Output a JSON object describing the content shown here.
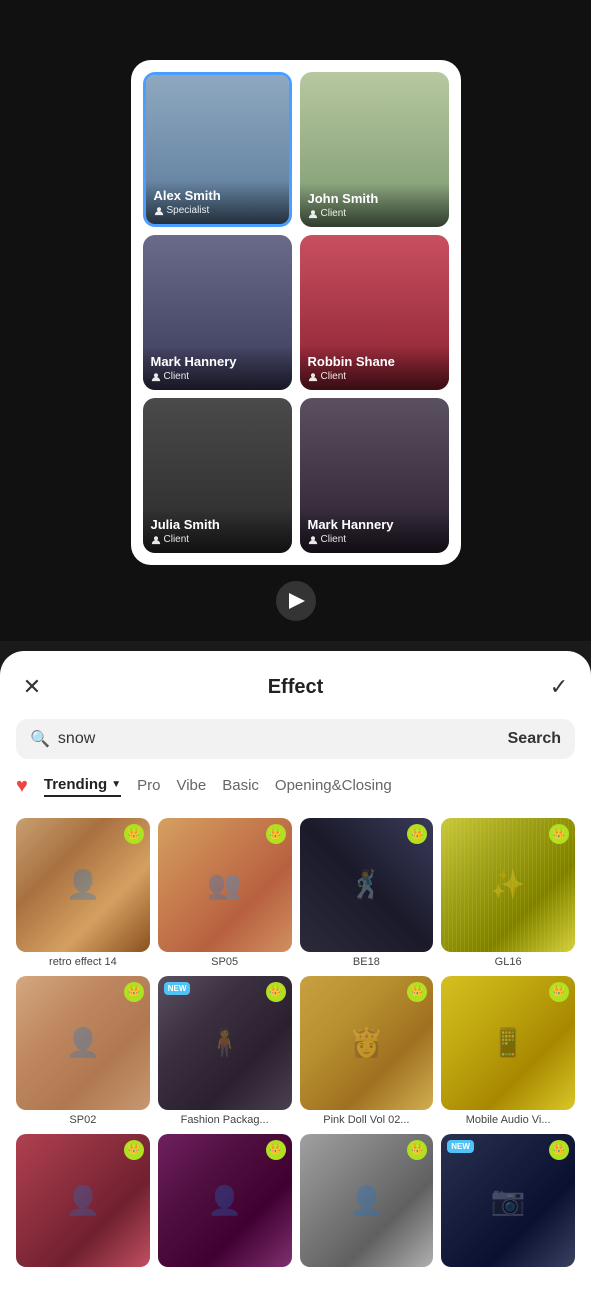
{
  "videoPreview": {
    "contacts": [
      {
        "id": "alex",
        "name": "Alex Smith",
        "role": "Specialist",
        "photoClass": "photo-alex",
        "selected": true
      },
      {
        "id": "john",
        "name": "John Smith",
        "role": "Client",
        "photoClass": "photo-john",
        "selected": false
      },
      {
        "id": "mark-h",
        "name": "Mark Hannery",
        "role": "Client",
        "photoClass": "photo-mark-h",
        "selected": false
      },
      {
        "id": "robbin",
        "name": "Robbin Shane",
        "role": "Client",
        "photoClass": "photo-robbin",
        "selected": false
      },
      {
        "id": "julia",
        "name": "Julia Smith",
        "role": "Client",
        "photoClass": "photo-julia",
        "selected": false
      },
      {
        "id": "mark-h2",
        "name": "Mark Hannery",
        "role": "Client",
        "photoClass": "photo-mark-h2",
        "selected": false
      }
    ]
  },
  "effectPanel": {
    "title": "Effect",
    "closeLabel": "✕",
    "checkLabel": "✓",
    "search": {
      "placeholder": "snow",
      "searchButtonLabel": "Search"
    },
    "categories": [
      {
        "id": "fav",
        "label": "♥",
        "type": "fav"
      },
      {
        "id": "trending",
        "label": "Trending",
        "active": true,
        "hasDropdown": true
      },
      {
        "id": "pro",
        "label": "Pro"
      },
      {
        "id": "vibe",
        "label": "Vibe"
      },
      {
        "id": "basic",
        "label": "Basic"
      },
      {
        "id": "opening",
        "label": "Opening&Closing"
      }
    ],
    "effects": [
      {
        "id": "retro14",
        "label": "retro effect 14",
        "thumbClass": "thumb-retro",
        "hasCrown": true,
        "isNew": false,
        "icon": "👤"
      },
      {
        "id": "sp05",
        "label": "SP05",
        "thumbClass": "thumb-sp05",
        "hasCrown": true,
        "isNew": false,
        "icon": "👥"
      },
      {
        "id": "be18",
        "label": "BE18",
        "thumbClass": "thumb-be18",
        "hasCrown": true,
        "isNew": false,
        "icon": "🕺"
      },
      {
        "id": "gl16",
        "label": "GL16",
        "thumbClass": "thumb-gl16",
        "hasCrown": true,
        "isNew": false,
        "icon": "✨"
      },
      {
        "id": "sp02",
        "label": "SP02",
        "thumbClass": "thumb-sp02",
        "hasCrown": true,
        "isNew": false,
        "icon": "👤"
      },
      {
        "id": "fashion",
        "label": "Fashion Packag...",
        "thumbClass": "thumb-fashion",
        "hasCrown": true,
        "isNew": true,
        "icon": "🧍"
      },
      {
        "id": "pinkdoll",
        "label": "Pink Doll Vol 02...",
        "thumbClass": "thumb-pinkdoll",
        "hasCrown": true,
        "isNew": false,
        "icon": "👸"
      },
      {
        "id": "mobile",
        "label": "Mobile Audio Vi...",
        "thumbClass": "thumb-mobile",
        "hasCrown": true,
        "isNew": false,
        "icon": "📱"
      },
      {
        "id": "row3a",
        "label": "",
        "thumbClass": "thumb-row3a",
        "hasCrown": true,
        "isNew": false,
        "icon": "👤"
      },
      {
        "id": "row3b",
        "label": "",
        "thumbClass": "thumb-row3b",
        "hasCrown": true,
        "isNew": false,
        "icon": "👤"
      },
      {
        "id": "row3c",
        "label": "",
        "thumbClass": "thumb-row3c",
        "hasCrown": true,
        "isNew": false,
        "icon": "👤"
      },
      {
        "id": "row3d",
        "label": "",
        "thumbClass": "thumb-row3d",
        "hasCrown": true,
        "isNew": true,
        "icon": "📷"
      }
    ]
  }
}
